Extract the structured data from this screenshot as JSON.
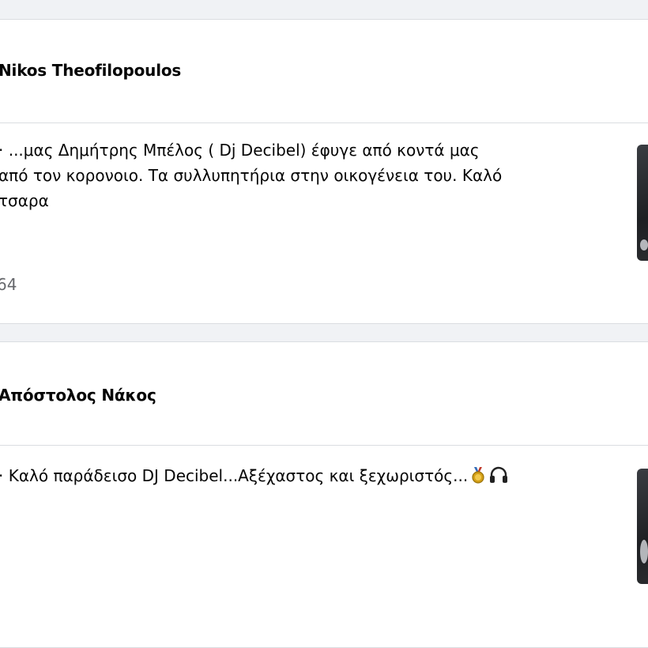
{
  "posts": [
    {
      "author": "Nikos Theofilopoulos",
      "lines": [
        "· ...μας Δημήτρης Μπέλος ( Dj Decibel) έφυγε από κοντά μας",
        "από τον κορονοιο. Τα συλλυπητήρια στην οικογένεια του. Καλό",
        "τσαρα"
      ],
      "count": "64",
      "thumbnail_icon": "post-photo"
    },
    {
      "author": "Απόστολος Νάκος",
      "text": "· Καλό παράδεισο DJ Decibel...Αξέχαστος και ξεχωριστός...",
      "emojis": [
        "medal-icon",
        "headphones-icon"
      ],
      "thumbnail_icon": "post-photo"
    }
  ]
}
